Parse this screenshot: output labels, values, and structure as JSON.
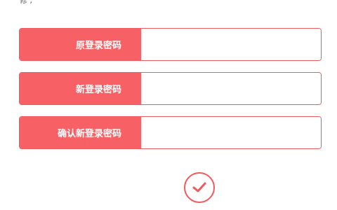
{
  "header": {
    "partial_text": "修 ,"
  },
  "form": {
    "fields": [
      {
        "label": "原登录密码",
        "value": "",
        "placeholder": ""
      },
      {
        "label": "新登录密码",
        "value": "",
        "placeholder": ""
      },
      {
        "label": "确认新登录密码",
        "value": "",
        "placeholder": ""
      }
    ],
    "confirm_icon": "check-icon"
  },
  "colors": {
    "accent": "#f76064",
    "border": "#f05a5e",
    "background": "#ffffff"
  }
}
